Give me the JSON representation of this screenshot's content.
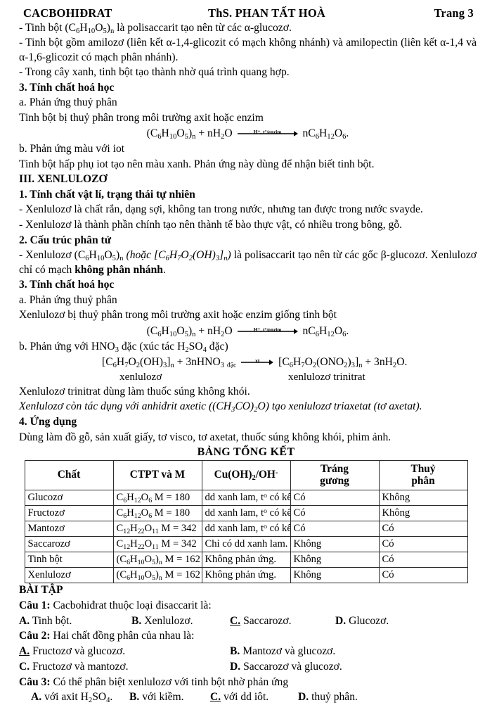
{
  "header": {
    "left": "CACBOHIĐRAT",
    "center": "ThS. PHAN TẤT HOÀ",
    "right": "Trang 3"
  },
  "starch_section": {
    "line1_prefix": "- Tinh bột (C",
    "line1": "- Tinh bột (C6H10O5)n là polisaccarit tạo nên từ các α-glucozơ.",
    "line2": "- Tinh bột gồm amilozơ (liên kết α-1,4-glicozit có mạch không nhánh) và amilopectin (liên kết α-1,4 và α-1,6-glicozit có mạch phân nhánh).",
    "line3": "- Trong cây xanh, tinh bột tạo thành nhờ quá trình quang hợp.",
    "heading3": "3. Tính chất hoá học",
    "sub_a": "a. Phản ứng thuỷ phân",
    "hydrolysis_text": "Tinh bột bị thuỷ phân trong môi trường axit hoặc enzim",
    "arrow_label": "H⁺, t°/enzim",
    "sub_b": "b. Phản ứng màu với iot",
    "iodine_text": "Tinh bột hấp phụ iot tạo nên màu xanh. Phản ứng này dùng để nhận biết tinh bột."
  },
  "cellulose_section": {
    "roman_heading": "III. XENLULOZƠ",
    "heading1": "1. Tính chất vật lí, trạng thái tự nhiên",
    "phys1": "- Xenlulozơ là chất rắn, dạng sợi, không tan trong nước, nhưng tan được trong nước svayde.",
    "phys2": "- Xenlulozơ là thành phần chính tạo nên thành tế bào thực vật, có nhiều trong bông, gỗ.",
    "heading2": "2. Cấu trúc phân tử",
    "struct_a": "- Xenlulozơ (C6H10O5)n",
    "struct_italic": "(hoặc [C6H7O2(OH)3]n)",
    "struct_b": "là polisaccarit tạo nên từ các gốc β-glucozơ. Xenlulozơ chỉ có mạch",
    "struct_bold": "không phân nhánh",
    "struct_end": ".",
    "heading3": "3. Tính chất hoá học",
    "sub_a": "a. Phản ứng thuỷ phân",
    "hydrolysis_text": "Xenlulozơ bị thuỷ phân trong môi trường axit hoặc enzim giống tinh bột",
    "arrow_label": "H⁺, t°/enzim",
    "sub_b": "b. Phản ứng với HNO3 đặc (xúc tác H2SO4 đặc)",
    "nitration_arrow_label": "xt",
    "caption_left": "xenlulozơ",
    "caption_right": "xenlulozơ trinitrat",
    "trinitrat_use": "Xenlulozơ trinitrat dùng làm thuốc súng không khói.",
    "acetic_note": "Xenlulozơ còn tác dụng với anhiđrit axetic ((CH3CO)2O) tạo xenlulozơ triaxetat (tơ axetat).",
    "heading4": "4. Ứng dụng",
    "application": "Dùng làm đồ gỗ, sản xuất giấy, tơ visco, tơ axetat, thuốc súng không khói, phim ảnh."
  },
  "table": {
    "title": "BẢNG TỔNG KẾT",
    "headers": [
      "Chất",
      "CTPT và M",
      "Cu(OH)2/OH⁻",
      "Tráng gương",
      "Thuỷ phân"
    ],
    "rows": [
      {
        "name": "Glucozơ",
        "formula": "C6H12O6 M = 180",
        "reaction": "dd xanh lam, t° có kết tủa đỏ gạch.",
        "mirror": "Có",
        "hydrolysis": "Không"
      },
      {
        "name": "Fructozơ",
        "formula": "C6H12O6 M = 180",
        "reaction": "dd xanh lam, t° có kết tủa đỏ gạch.",
        "mirror": "Có",
        "hydrolysis": "Không"
      },
      {
        "name": "Mantozơ",
        "formula": "C12H22O11 M = 342",
        "reaction": "dd xanh lam, t° có kết tủa đỏ gạch.",
        "mirror": "Có",
        "hydrolysis": "Có"
      },
      {
        "name": "Saccarozơ",
        "formula": "C12H22O11 M = 342",
        "reaction": "Chỉ có dd xanh lam.",
        "mirror": "Không",
        "hydrolysis": "Có"
      },
      {
        "name": "Tinh bột",
        "formula": "(C6H10O5)n M = 162",
        "reaction": "Không phản ứng.",
        "mirror": "Không",
        "hydrolysis": "Có"
      },
      {
        "name": "Xenlulozơ",
        "formula": "(C6H10O5)n M = 162",
        "reaction": "Không phản ứng.",
        "mirror": "Không",
        "hydrolysis": "Có"
      }
    ]
  },
  "exercises": {
    "title": "BÀI TẬP",
    "q1": {
      "stem": "Câu 1: Cacbohiđrat thuộc loại đisaccarit là:",
      "a": "A. Tinh bột.",
      "b": "B. Xenlulozơ.",
      "c_letter": "C.",
      "c_text": " Saccarozơ.",
      "d": "D. Glucozơ."
    },
    "q2": {
      "stem": "Câu 2: Hai chất đồng phân của nhau là:",
      "a_letter": "A.",
      "a_text": " Fructozơ và glucozơ.",
      "b": "B. Mantozơ và glucozơ.",
      "c": "C. Fructozơ và mantozơ.",
      "d": "D. Saccarozơ và glucozơ."
    },
    "q3": {
      "stem": "Câu 3: Có thể phân biệt xenlulozơ với tinh bột nhờ phản ứng",
      "a": "A. với axit H2SO4.",
      "b": "B. với kiềm.",
      "c_letter": "C.",
      "c_text": " với dd iôt.",
      "d": "D. thuỷ phân."
    }
  }
}
